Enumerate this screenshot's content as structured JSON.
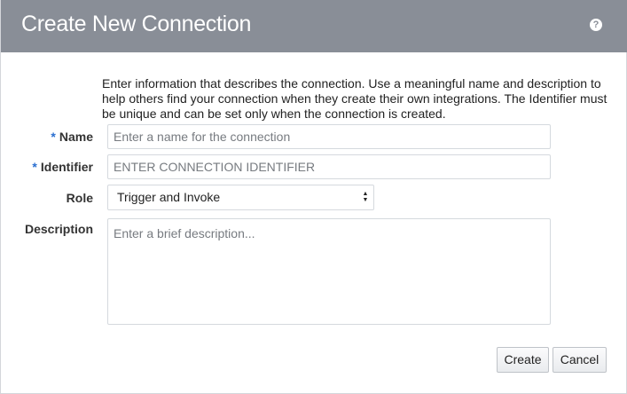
{
  "dialog": {
    "title": "Create New Connection",
    "help_icon": "?",
    "intro": "Enter information that describes the connection. Use a meaningful name and description to help others find your connection when they create their own integrations. The Identifier must be unique and can be set only when the connection is created."
  },
  "form": {
    "required_marker": "*",
    "name": {
      "label": "Name",
      "value": "",
      "placeholder": "Enter a name for the connection"
    },
    "identifier": {
      "label": "Identifier",
      "value": "",
      "placeholder": "ENTER CONNECTION IDENTIFIER"
    },
    "role": {
      "label": "Role",
      "selected": "Trigger and Invoke"
    },
    "description": {
      "label": "Description",
      "value": "",
      "placeholder": "Enter a brief description..."
    }
  },
  "buttons": {
    "create": "Create",
    "cancel": "Cancel"
  },
  "colors": {
    "titlebar": "#898e97",
    "required_marker": "#2a6fd0"
  }
}
